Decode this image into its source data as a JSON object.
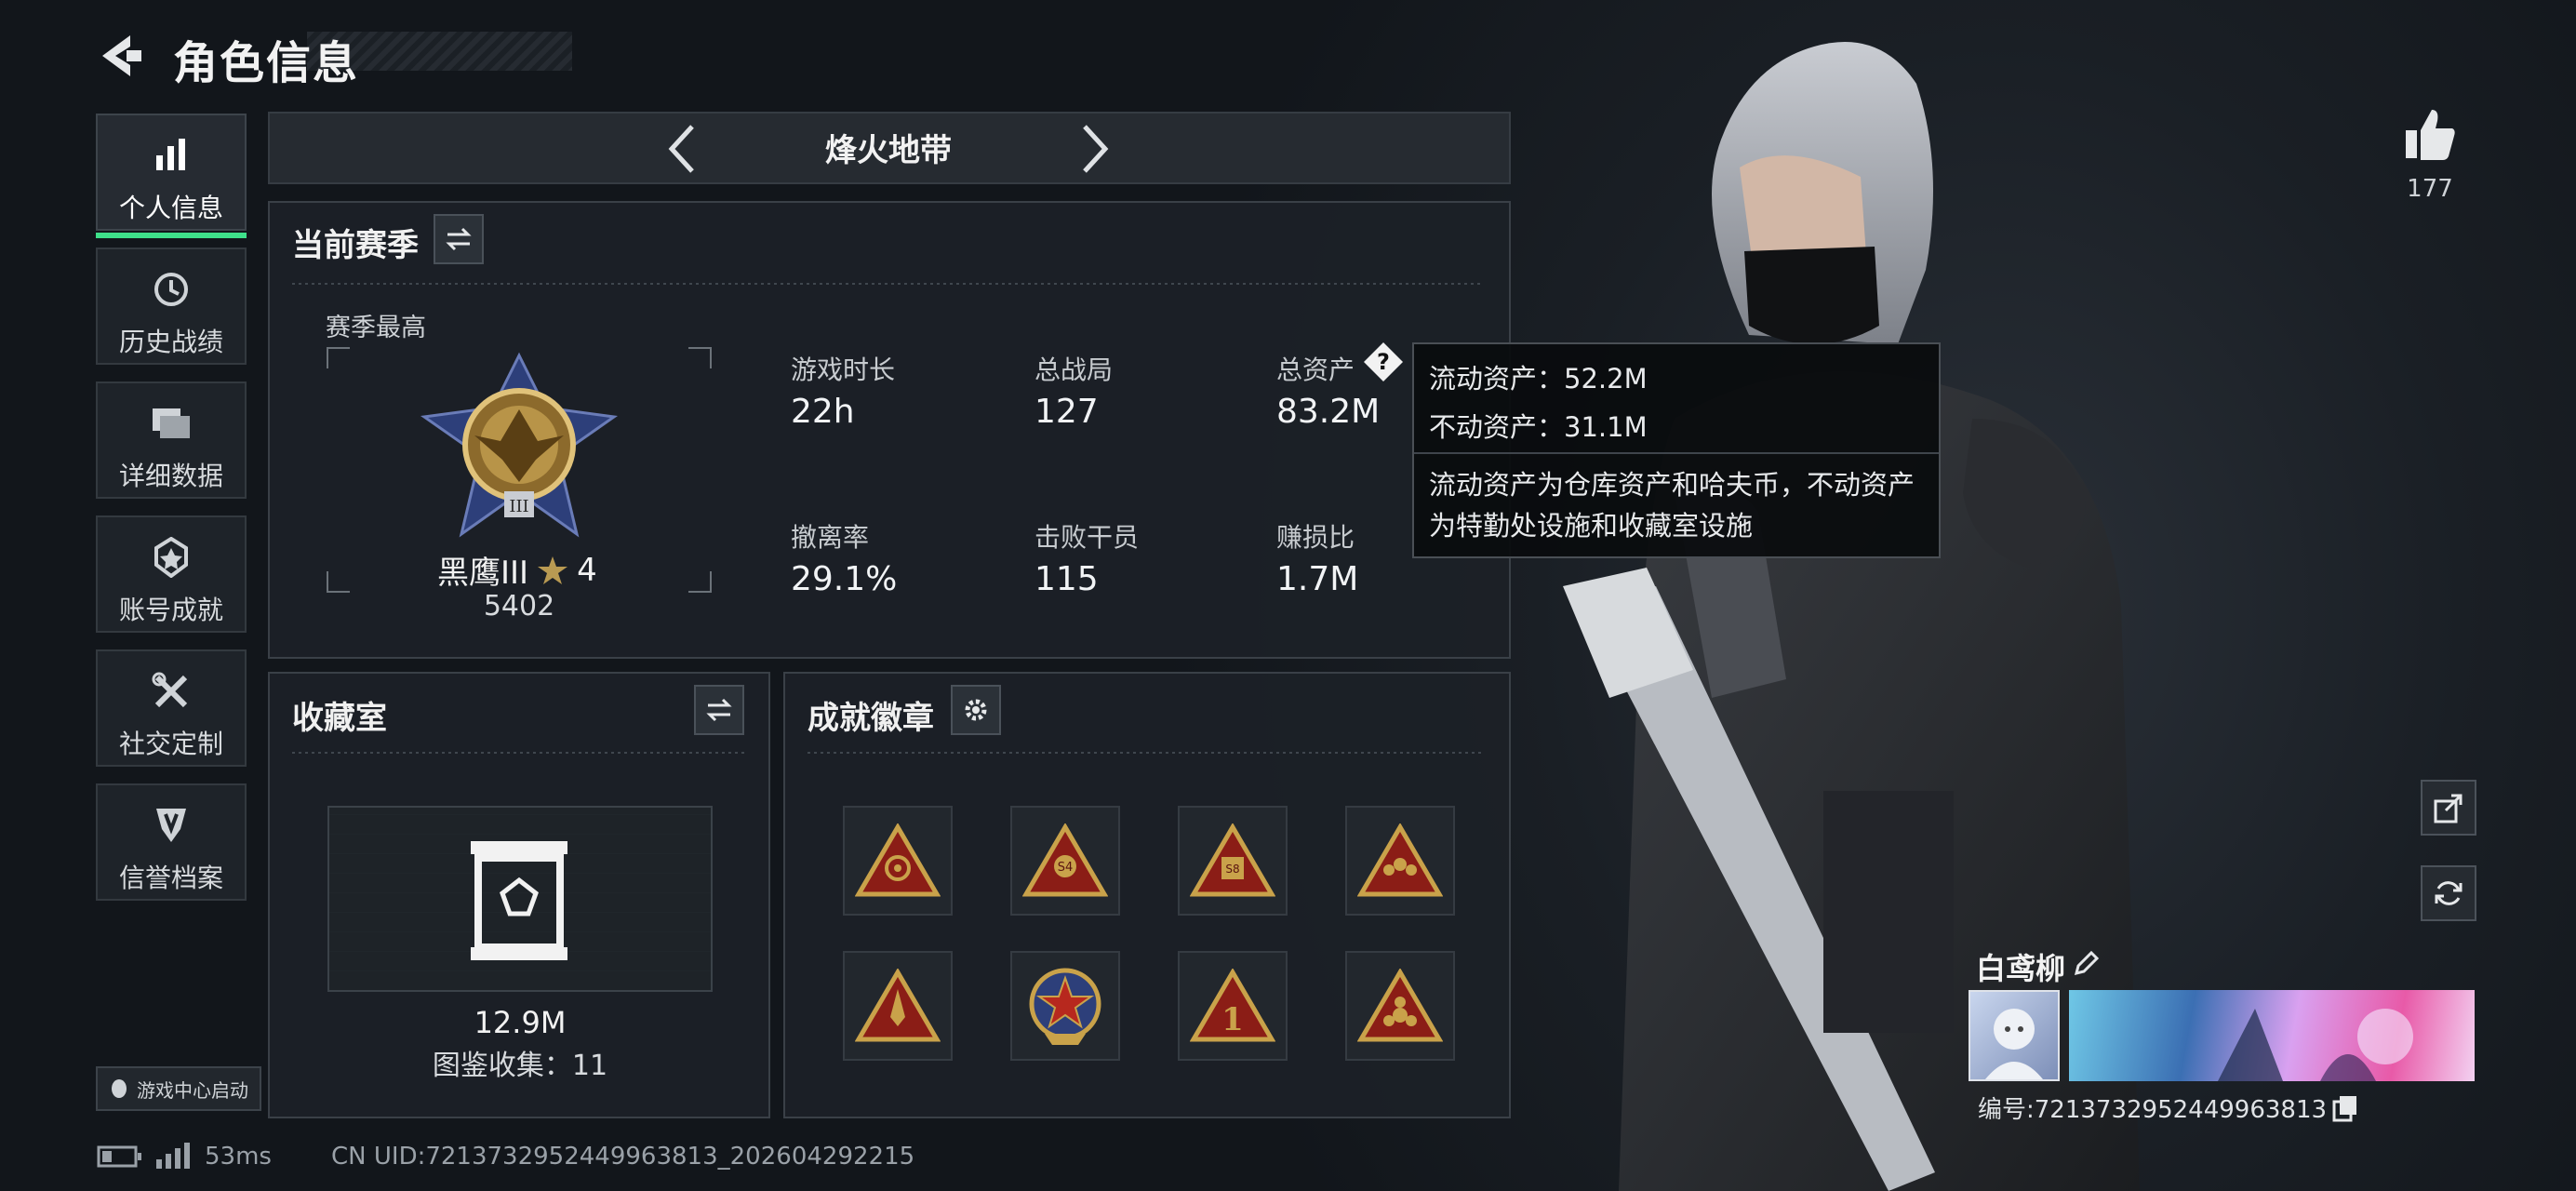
{
  "header": {
    "title": "角色信息"
  },
  "sidebar": {
    "items": [
      {
        "label": "个人信息",
        "icon": "bar-chart-icon"
      },
      {
        "label": "历史战绩",
        "icon": "history-clock-icon"
      },
      {
        "label": "详细数据",
        "icon": "folder-icon"
      },
      {
        "label": "账号成就",
        "icon": "achievement-icon"
      },
      {
        "label": "社交定制",
        "icon": "tools-icon"
      },
      {
        "label": "信誉档案",
        "icon": "shield-icon"
      }
    ],
    "game_center_label": "游戏中心启动"
  },
  "mode_selector": {
    "label": "烽火地带"
  },
  "season": {
    "title": "当前赛季",
    "peak_label": "赛季最高",
    "rank_name": "黑鹰III",
    "rank_stars": "4",
    "rank_score": "5402",
    "stats": [
      {
        "label": "游戏时长",
        "value": "22h"
      },
      {
        "label": "总战局",
        "value": "127"
      },
      {
        "label": "总资产",
        "value": "83.2M"
      },
      {
        "label": "撤离率",
        "value": "29.1%"
      },
      {
        "label": "击败干员",
        "value": "115"
      },
      {
        "label": "赚损比",
        "value": "1.7M"
      }
    ]
  },
  "tooltip": {
    "liquid": "流动资产：52.2M",
    "fixed": "不动资产：31.1M",
    "desc_line1": "流动资产为仓库资产和哈夫币，不动资产",
    "desc_line2": "为特勤处设施和收藏室设施"
  },
  "collection": {
    "title": "收藏室",
    "value": "12.9M",
    "count_label": "图鉴收集：11"
  },
  "achievements": {
    "title": "成就徽章",
    "badge_icons": [
      "eye-badge-icon",
      "s4-badge-icon",
      "s8-badge-icon",
      "squad-badge-icon",
      "rocket-badge-icon",
      "star-medal-badge-icon",
      "number-one-badge-icon",
      "flower-badge-icon"
    ]
  },
  "likes": {
    "count": "177"
  },
  "player": {
    "name": "白鸢柳",
    "id_label": "编号:7213732952449963813"
  },
  "status_bar": {
    "ping": "53ms",
    "uid": "CN UID:7213732952449963813_202604292215"
  },
  "colors": {
    "accent_green": "#3ee08a",
    "gold": "#c9a24a",
    "badge_red": "#8b1d16"
  }
}
